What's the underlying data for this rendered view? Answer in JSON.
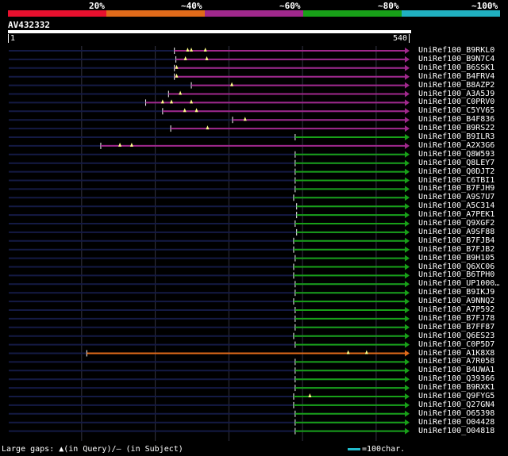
{
  "color_legend": {
    "labels": [
      "20%",
      "~40%",
      "~60%",
      "~80%",
      "~100%"
    ],
    "colors": [
      "#e8102e",
      "#e06a1a",
      "#a0288c",
      "#18a018",
      "#20b0c0"
    ]
  },
  "query": {
    "id": "AV432332",
    "start": "1",
    "end": "540",
    "length": 540
  },
  "chart_data": {
    "type": "alignment",
    "query_length": 540,
    "hits": [
      {
        "name": "UniRef100_B9RKL0",
        "start": 226,
        "end": 540,
        "color": "#a0288c",
        "insertions": [
          244,
          249,
          268
        ]
      },
      {
        "name": "UniRef100_B9N7C4",
        "start": 228,
        "end": 540,
        "color": "#a0288c",
        "insertions": [
          241,
          270
        ]
      },
      {
        "name": "UniRef100_B6SSK1",
        "start": 226,
        "end": 540,
        "color": "#a0288c",
        "insertions": [
          229
        ]
      },
      {
        "name": "UniRef100_B4FRV4",
        "start": 226,
        "end": 540,
        "color": "#a0288c",
        "insertions": [
          229
        ]
      },
      {
        "name": "UniRef100_B8AZP2",
        "start": 249,
        "end": 540,
        "color": "#a0288c",
        "insertions": [
          304
        ]
      },
      {
        "name": "UniRef100_A3A5J9",
        "start": 218,
        "end": 540,
        "color": "#a0288c",
        "insertions": [
          234
        ]
      },
      {
        "name": "UniRef100_C0PRV0",
        "start": 187,
        "end": 540,
        "color": "#a0288c",
        "insertions": [
          210,
          222,
          249
        ]
      },
      {
        "name": "UniRef100_C5YV65",
        "start": 210,
        "end": 540,
        "color": "#a0288c",
        "insertions": [
          240,
          256
        ]
      },
      {
        "name": "UniRef100_B4F836",
        "start": 305,
        "end": 540,
        "color": "#a0288c",
        "insertions": [
          322
        ]
      },
      {
        "name": "UniRef100_B9RS22",
        "start": 221,
        "end": 540,
        "color": "#a0288c",
        "insertions": [
          271
        ]
      },
      {
        "name": "UniRef100_B9ILR3",
        "start": 390,
        "end": 540,
        "color": "#18a018",
        "insertions": []
      },
      {
        "name": "UniRef100_A2X3G6",
        "start": 126,
        "end": 540,
        "color": "#a0288c",
        "insertions": [
          152,
          168
        ]
      },
      {
        "name": "UniRef100_Q8W593",
        "start": 390,
        "end": 540,
        "color": "#18a018",
        "insertions": []
      },
      {
        "name": "UniRef100_Q8LEY7",
        "start": 390,
        "end": 540,
        "color": "#18a018",
        "insertions": []
      },
      {
        "name": "UniRef100_Q0DJT2",
        "start": 390,
        "end": 540,
        "color": "#18a018",
        "insertions": []
      },
      {
        "name": "UniRef100_C6TBI1",
        "start": 390,
        "end": 540,
        "color": "#18a018",
        "insertions": []
      },
      {
        "name": "UniRef100_B7FJH9",
        "start": 390,
        "end": 540,
        "color": "#18a018",
        "insertions": []
      },
      {
        "name": "UniRef100_A9S7U7",
        "start": 388,
        "end": 540,
        "color": "#18a018",
        "insertions": []
      },
      {
        "name": "UniRef100_A5C314",
        "start": 392,
        "end": 540,
        "color": "#18a018",
        "insertions": []
      },
      {
        "name": "UniRef100_A7PEK1",
        "start": 392,
        "end": 540,
        "color": "#18a018",
        "insertions": []
      },
      {
        "name": "UniRef100_Q9XGF2",
        "start": 390,
        "end": 540,
        "color": "#18a018",
        "insertions": []
      },
      {
        "name": "UniRef100_A9SF88",
        "start": 392,
        "end": 540,
        "color": "#18a018",
        "insertions": []
      },
      {
        "name": "UniRef100_B7FJB4",
        "start": 388,
        "end": 540,
        "color": "#18a018",
        "insertions": []
      },
      {
        "name": "UniRef100_B7FJB2",
        "start": 388,
        "end": 540,
        "color": "#18a018",
        "insertions": []
      },
      {
        "name": "UniRef100_B9H105",
        "start": 390,
        "end": 540,
        "color": "#18a018",
        "insertions": []
      },
      {
        "name": "UniRef100_Q6XC06",
        "start": 388,
        "end": 540,
        "color": "#18a018",
        "insertions": []
      },
      {
        "name": "UniRef100_B6TPH0",
        "start": 388,
        "end": 540,
        "color": "#18a018",
        "insertions": []
      },
      {
        "name": "UniRef100_UP1000…",
        "start": 390,
        "end": 540,
        "color": "#18a018",
        "insertions": []
      },
      {
        "name": "UniRef100_B9IKJ9",
        "start": 390,
        "end": 540,
        "color": "#18a018",
        "insertions": []
      },
      {
        "name": "UniRef100_A9NNQ2",
        "start": 388,
        "end": 540,
        "color": "#18a018",
        "insertions": []
      },
      {
        "name": "UniRef100_A7P592",
        "start": 390,
        "end": 540,
        "color": "#18a018",
        "insertions": []
      },
      {
        "name": "UniRef100_B7FJ78",
        "start": 390,
        "end": 540,
        "color": "#18a018",
        "insertions": []
      },
      {
        "name": "UniRef100_B7FF87",
        "start": 390,
        "end": 540,
        "color": "#18a018",
        "insertions": []
      },
      {
        "name": "UniRef100_Q6ES23",
        "start": 388,
        "end": 540,
        "color": "#18a018",
        "insertions": []
      },
      {
        "name": "UniRef100_C0P5D7",
        "start": 390,
        "end": 540,
        "color": "#18a018",
        "insertions": []
      },
      {
        "name": "UniRef100_A1K8X8",
        "start": 107,
        "end": 540,
        "color": "#e06a1a",
        "insertions": [
          462,
          487
        ]
      },
      {
        "name": "UniRef100_A7R058",
        "start": 390,
        "end": 540,
        "color": "#18a018",
        "insertions": []
      },
      {
        "name": "UniRef100_B4UWA1",
        "start": 390,
        "end": 540,
        "color": "#18a018",
        "insertions": []
      },
      {
        "name": "UniRef100_Q39366",
        "start": 390,
        "end": 540,
        "color": "#18a018",
        "insertions": []
      },
      {
        "name": "UniRef100_B9RXK1",
        "start": 390,
        "end": 540,
        "color": "#18a018",
        "insertions": []
      },
      {
        "name": "UniRef100_Q9FYG5",
        "start": 388,
        "end": 540,
        "color": "#18a018",
        "insertions": [
          410
        ]
      },
      {
        "name": "UniRef100_Q27GN4",
        "start": 388,
        "end": 540,
        "color": "#18a018",
        "insertions": []
      },
      {
        "name": "UniRef100_O65398",
        "start": 390,
        "end": 540,
        "color": "#18a018",
        "insertions": []
      },
      {
        "name": "UniRef100_O04428",
        "start": 390,
        "end": 540,
        "color": "#18a018",
        "insertions": []
      },
      {
        "name": "UniRef100_O04818",
        "start": 390,
        "end": 540,
        "color": "#18a018",
        "insertions": []
      }
    ]
  },
  "footer": {
    "gaps_text": "Large gaps: ▲(in Query)/— (in Subject)",
    "scale_text": "=100char."
  }
}
